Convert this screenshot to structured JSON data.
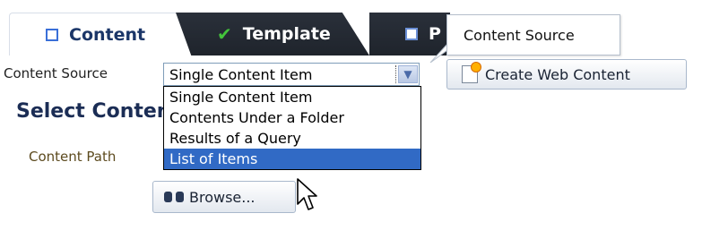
{
  "tabs": [
    {
      "label": "Content",
      "icon": "checkbox-icon",
      "state": "active"
    },
    {
      "label": "Template",
      "icon": "checkmark-icon",
      "state": "inactive"
    },
    {
      "label": "P",
      "icon": "checkbox-icon",
      "state": "inactive-truncated"
    }
  ],
  "form": {
    "content_source_label": "Content Source",
    "content_source_value": "Single Content Item",
    "options": [
      "Single Content Item",
      "Contents Under a Folder",
      "Results of a Query",
      "List of Items"
    ],
    "highlighted_option": "List of Items",
    "create_button_label": "Create Web Content",
    "tooltip_text": "Content Source",
    "heading": "Select Content",
    "content_path_label": "Content Path",
    "browse_button_label": "Browse..."
  },
  "colors": {
    "accent_blue": "#316ac5",
    "tab_dark": "#23282f",
    "heading": "#1b2d55"
  }
}
